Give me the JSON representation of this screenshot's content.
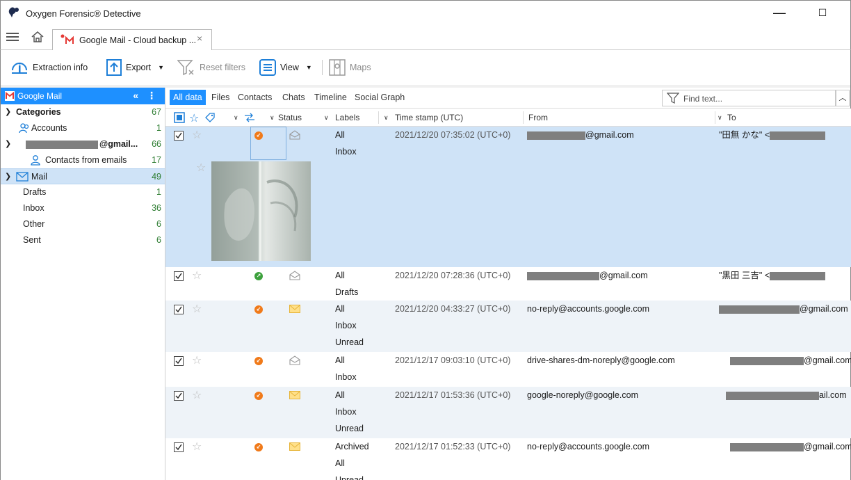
{
  "window": {
    "title": "Oxygen Forensic® Detective",
    "minimize": "—",
    "maximize": "☐"
  },
  "tabs": {
    "active_tab_label": "Google Mail - Cloud backup ...",
    "close": "×"
  },
  "toolbar": {
    "extraction_info": "Extraction info",
    "export": "Export",
    "reset_filters": "Reset filters",
    "view": "View",
    "maps": "Maps"
  },
  "sidebar": {
    "header": "Google Mail",
    "header_controls": "«  ⋮",
    "items": [
      {
        "label": "Categories",
        "count": "67"
      },
      {
        "label": "Accounts",
        "count": "1"
      },
      {
        "label": "@gmail...",
        "count": "66"
      },
      {
        "label": "Contacts from emails",
        "count": "17"
      },
      {
        "label": "Mail",
        "count": "49"
      },
      {
        "label": "Drafts",
        "count": "1"
      },
      {
        "label": "Inbox",
        "count": "36"
      },
      {
        "label": "Other",
        "count": "6"
      },
      {
        "label": "Sent",
        "count": "6"
      }
    ]
  },
  "subtabs": [
    "All data",
    "Files",
    "Contacts",
    "Chats",
    "Timeline",
    "Social Graph"
  ],
  "search": {
    "placeholder": "Find text..."
  },
  "columns": {
    "status": "Status",
    "labels": "Labels",
    "timestamp": "Time stamp (UTC)",
    "from": "From",
    "to": "To"
  },
  "rows": [
    {
      "direction": "in",
      "read": true,
      "labels": [
        "All",
        "Inbox"
      ],
      "timestamp": "2021/12/20 07:35:02 (UTC+0)",
      "from": "@gmail.com",
      "to": "\"田無 かな\" <",
      "selected": true
    },
    {
      "direction": "out",
      "read": true,
      "labels": [
        "All",
        "Drafts"
      ],
      "timestamp": "2021/12/20 07:28:36 (UTC+0)",
      "from": "@gmail.com",
      "to": "\"黒田 三吉\" <"
    },
    {
      "direction": "in",
      "read": false,
      "labels": [
        "All",
        "Inbox",
        "Unread"
      ],
      "timestamp": "2021/12/20 04:33:27 (UTC+0)",
      "from": "no-reply@accounts.google.com",
      "to": "@gmail.com"
    },
    {
      "direction": "in",
      "read": true,
      "labels": [
        "All",
        "Inbox"
      ],
      "timestamp": "2021/12/17 09:03:10 (UTC+0)",
      "from": "drive-shares-dm-noreply@google.com",
      "to": "@gmail.com"
    },
    {
      "direction": "in",
      "read": false,
      "labels": [
        "All",
        "Inbox",
        "Unread"
      ],
      "timestamp": "2021/12/17 01:53:36 (UTC+0)",
      "from": "google-noreply@google.com",
      "to": "ail.com"
    },
    {
      "direction": "in",
      "read": false,
      "labels": [
        "Archived",
        "All",
        "Unread"
      ],
      "timestamp": "2021/12/17 01:52:33 (UTC+0)",
      "from": "no-reply@accounts.google.com",
      "to": "@gmail.com"
    }
  ]
}
